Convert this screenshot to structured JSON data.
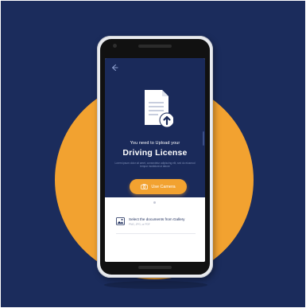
{
  "colors": {
    "background": "#1b2c5c",
    "accent_circle": "#f2a230",
    "screen_header": "#1a2a5a",
    "button": "#f2a230",
    "text_light": "#ffffff",
    "text_dark": "#1a2a5a"
  },
  "icons": {
    "back": "back-arrow-icon",
    "document": "document-upload-icon",
    "camera": "camera-icon",
    "gallery": "gallery-image-icon"
  },
  "upload": {
    "prompt": "You need to Upload your",
    "document_type": "Driving License",
    "description": "Lorem ipsum dolor sit amet, consectetur adipiscing elit, sed do eiusmod tempor incididunt ut labore"
  },
  "actions": {
    "camera_label": "Use Camera",
    "gallery_title": "Select the documents from Gallery",
    "gallery_subtitle": "PNG, JPG, or PDF"
  }
}
